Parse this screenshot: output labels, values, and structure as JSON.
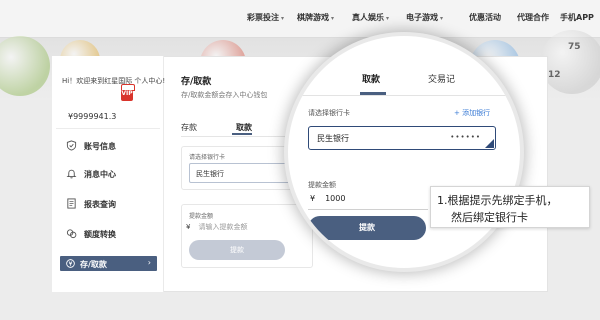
{
  "nav": {
    "items": [
      {
        "label": "彩票投注",
        "chevron": true
      },
      {
        "label": "棋牌游戏",
        "chevron": true
      },
      {
        "label": "真人娱乐",
        "chevron": true
      },
      {
        "label": "电子游戏",
        "chevron": true
      },
      {
        "label": "优惠活动",
        "chevron": false
      },
      {
        "label": "代理合作",
        "chevron": false
      },
      {
        "label": "手机APP",
        "chevron": false
      }
    ]
  },
  "background": {
    "ball_numbers": [
      "75",
      "12"
    ]
  },
  "sidebar": {
    "welcome": "Hi！欢迎来到红星国际 个人中心!",
    "vip_badge": "VIP",
    "balance": "¥9999941.3",
    "menu": [
      {
        "label": "账号信息",
        "icon": "shield-check-icon"
      },
      {
        "label": "消息中心",
        "icon": "bell-icon"
      },
      {
        "label": "报表查询",
        "icon": "document-icon"
      },
      {
        "label": "额度转换",
        "icon": "transfer-icon"
      }
    ],
    "active_item": {
      "label": "存/取款",
      "icon": "yen-circle-icon",
      "arrow": "›"
    }
  },
  "content": {
    "title": "存/取款",
    "subtitle": "存/取款金额会存入中心钱包",
    "tabs": [
      "存款",
      "取款",
      "交"
    ],
    "bank_label": "请选择银行卡",
    "bank_value": "民生银行",
    "amount_label": "提款金额",
    "amount_currency": "¥",
    "amount_placeholder": "请输入提款金额",
    "submit_label": "提款"
  },
  "magnifier": {
    "tab_active": "取款",
    "tab_other": "交易记",
    "bank_label": "请选择银行卡",
    "add_link": "+ 添加银行",
    "bank_value": "民生银行",
    "card_mask": "••••••",
    "amount_label": "提款金额",
    "amount_currency": "¥",
    "amount_value": "1000",
    "submit_label": "提款"
  },
  "tooltip": {
    "line1": "1.根据提示先绑定手机，",
    "line2": "然后绑定银行卡"
  }
}
